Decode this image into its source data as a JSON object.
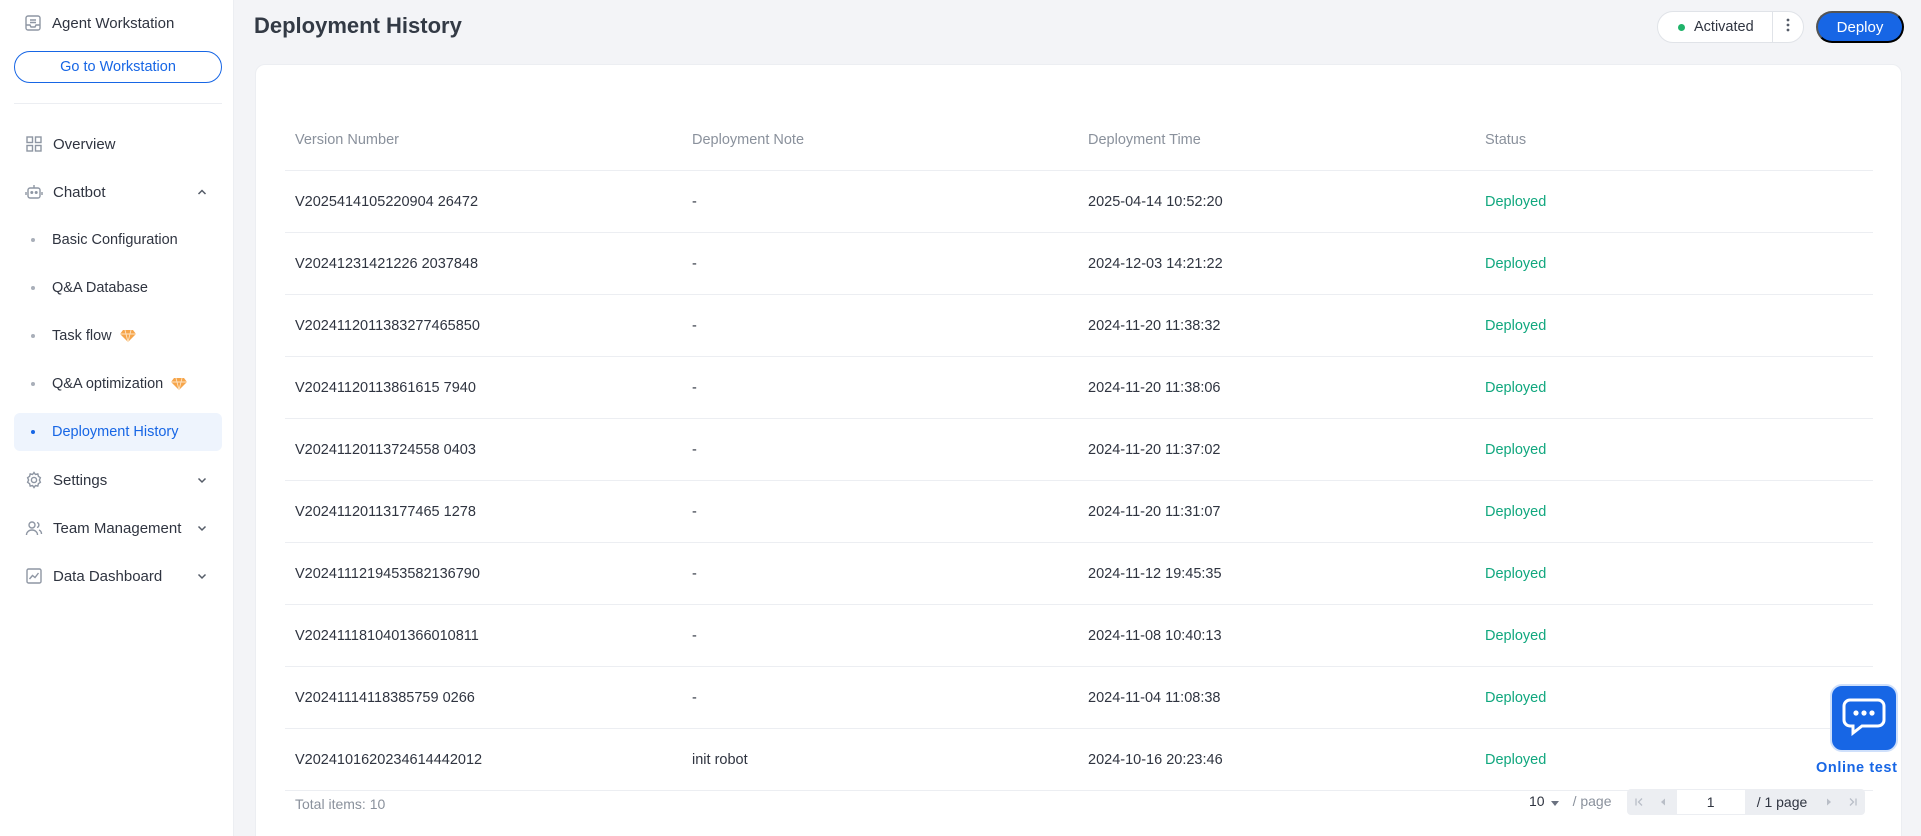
{
  "sidebar": {
    "header": "Agent Workstation",
    "goto_button": "Go to Workstation",
    "items": [
      {
        "label": "Overview",
        "icon": "grid-icon"
      },
      {
        "label": "Chatbot",
        "icon": "robot-icon",
        "expanded": true
      },
      {
        "label": "Settings",
        "icon": "gear-icon"
      },
      {
        "label": "Team Management",
        "icon": "users-icon"
      },
      {
        "label": "Data Dashboard",
        "icon": "chart-icon"
      }
    ],
    "chatbot_sub": [
      {
        "label": "Basic Configuration"
      },
      {
        "label": "Q&A Database"
      },
      {
        "label": "Task flow",
        "premium": true
      },
      {
        "label": "Q&A optimization",
        "premium": true
      },
      {
        "label": "Deployment History",
        "active": true
      }
    ]
  },
  "header": {
    "title": "Deployment History",
    "status": "Activated",
    "status_color": "#1fb36a",
    "deploy_button": "Deploy",
    "accent": "#1766e5"
  },
  "table": {
    "columns": [
      "Version Number",
      "Deployment Note",
      "Deployment Time",
      "Status"
    ],
    "rows": [
      [
        "V2025414105220904 26472",
        "-",
        "2025-04-14 10:52:20",
        "Deployed"
      ],
      [
        "V20241231421226 2037848",
        "-",
        "2024-12-03 14:21:22",
        "Deployed"
      ],
      [
        "V2024112011383277465850",
        "-",
        "2024-11-20 11:38:32",
        "Deployed"
      ],
      [
        "V20241120113861615 7940",
        "-",
        "2024-11-20 11:38:06",
        "Deployed"
      ],
      [
        "V20241120113724558 0403",
        "-",
        "2024-11-20 11:37:02",
        "Deployed"
      ],
      [
        "V20241120113177465 1278",
        "-",
        "2024-11-20 11:31:07",
        "Deployed"
      ],
      [
        "V2024111219453582136790",
        "-",
        "2024-11-12 19:45:35",
        "Deployed"
      ],
      [
        "V2024111810401366010811",
        "-",
        "2024-11-08 10:40:13",
        "Deployed"
      ],
      [
        "V20241114118385759 0266",
        "-",
        "2024-11-04 11:08:38",
        "Deployed"
      ],
      [
        "V2024101620234614442012",
        "init robot",
        "2024-10-16 20:23:46",
        "Deployed"
      ]
    ],
    "status_color": "#10a77e"
  },
  "pagination": {
    "total_label": "Total items:",
    "total": "10",
    "page_size": "10",
    "per_page": "/ page",
    "current_page": "1",
    "of_pages": "/ 1 page"
  },
  "online_test": {
    "label": "Online test"
  }
}
